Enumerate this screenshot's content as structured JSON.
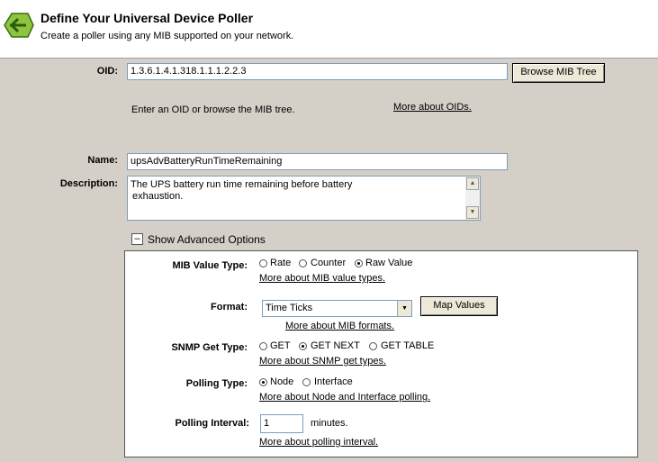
{
  "header": {
    "title": "Define Your Universal Device Poller",
    "subtitle": "Create a poller using any MIB supported on your network."
  },
  "oid": {
    "label": "OID:",
    "value": "1.3.6.1.4.1.318.1.1.1.2.2.3",
    "browse_button": "Browse MIB Tree",
    "hint": "Enter an OID or browse the MIB tree.",
    "more_link": "More about OIDs."
  },
  "name": {
    "label": "Name:",
    "value": "upsAdvBatteryRunTimeRemaining"
  },
  "description": {
    "label": "Description:",
    "line1": "The UPS battery run time remaining before battery",
    "line2": "exhaustion."
  },
  "advanced_toggle": {
    "symbol": "–",
    "label": "Show Advanced Options"
  },
  "advanced": {
    "mib_value_type": {
      "label": "MIB Value Type:",
      "options": [
        "Rate",
        "Counter",
        "Raw Value"
      ],
      "selected": "Raw Value",
      "more_link": "More about MIB value types."
    },
    "format": {
      "label": "Format:",
      "value": "Time Ticks",
      "map_button": "Map Values",
      "more_link": "More about MIB formats."
    },
    "snmp_get_type": {
      "label": "SNMP Get Type:",
      "options": [
        "GET",
        "GET NEXT",
        "GET TABLE"
      ],
      "selected": "GET NEXT",
      "more_link": "More about SNMP get types."
    },
    "polling_type": {
      "label": "Polling Type:",
      "options": [
        "Node",
        "Interface"
      ],
      "selected": "Node",
      "more_link": "More about Node and Interface polling."
    },
    "polling_interval": {
      "label": "Polling Interval:",
      "value": "1",
      "unit": "minutes.",
      "more_link": "More about polling interval."
    }
  }
}
